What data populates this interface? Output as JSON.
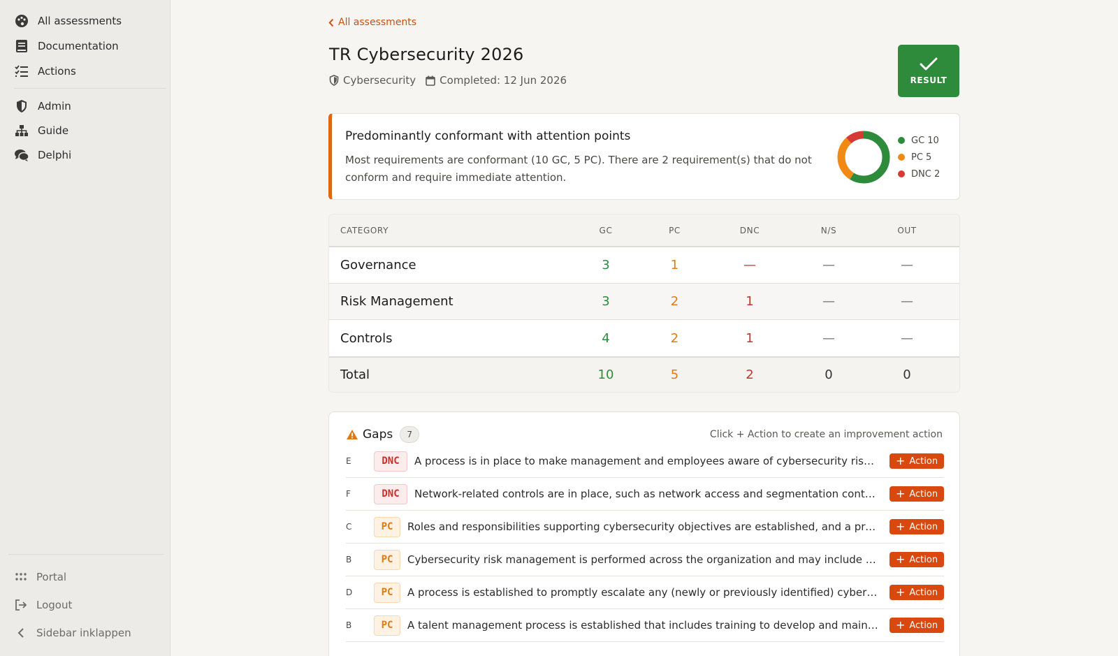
{
  "sidebar": {
    "nav": [
      {
        "label": "All assessments",
        "icon": "palette-icon"
      },
      {
        "label": "Documentation",
        "icon": "book-icon"
      },
      {
        "label": "Actions",
        "icon": "checklist-icon"
      },
      {
        "label": "Admin",
        "icon": "shield-icon"
      },
      {
        "label": "Guide",
        "icon": "sitemap-icon"
      },
      {
        "label": "Delphi",
        "icon": "comments-icon"
      }
    ],
    "bottom": [
      {
        "label": "Portal",
        "icon": "grid-icon"
      },
      {
        "label": "Logout",
        "icon": "logout-icon"
      },
      {
        "label": "Sidebar inklappen",
        "icon": "chevron-left-icon"
      }
    ]
  },
  "header": {
    "back_label": "All assessments",
    "title": "TR Cybersecurity 2026",
    "category": "Cybersecurity",
    "completed": "Completed: 12 Jun 2026",
    "result_label": "RESULT"
  },
  "summary": {
    "title": "Predominantly conformant with attention points",
    "text": "Most requirements are conformant (10 GC, 5 PC). There are 2 requirement(s) that do not conform and require immediate attention.",
    "donut": [
      {
        "label": "GC 10",
        "value": 10,
        "color": "#2e8b3c"
      },
      {
        "label": "PC 5",
        "value": 5,
        "color": "#f08a14"
      },
      {
        "label": "DNC 2",
        "value": 2,
        "color": "#d63a34"
      }
    ]
  },
  "table": {
    "headers": {
      "category": "CATEGORY",
      "gc": "GC",
      "pc": "PC",
      "dnc": "DNC",
      "ns": "N/S",
      "out": "OUT"
    },
    "rows": [
      {
        "category": "Governance",
        "gc": "3",
        "pc": "1",
        "dnc": "—",
        "ns": "—",
        "out": "—"
      },
      {
        "category": "Risk Management",
        "gc": "3",
        "pc": "2",
        "dnc": "1",
        "ns": "—",
        "out": "—"
      },
      {
        "category": "Controls",
        "gc": "4",
        "pc": "2",
        "dnc": "1",
        "ns": "—",
        "out": "—"
      }
    ],
    "total": {
      "category": "Total",
      "gc": "10",
      "pc": "5",
      "dnc": "2",
      "ns": "0",
      "out": "0"
    }
  },
  "gaps": {
    "title": "Gaps",
    "count": "7",
    "hint": "Click + Action to create an improvement action",
    "action_label": "Action",
    "items": [
      {
        "letter": "E",
        "status": "DNC",
        "text": "A process is in place to make management and employees aware of cybersecurity risks a..."
      },
      {
        "letter": "F",
        "status": "DNC",
        "text": "Network-related controls are in place, such as network access and segmentation controls..."
      },
      {
        "letter": "C",
        "status": "PC",
        "text": "Roles and responsibilities supporting cybersecurity objectives are established, and a proce..."
      },
      {
        "letter": "B",
        "status": "PC",
        "text": "Cybersecurity risk management is performed across the organization and may include the ..."
      },
      {
        "letter": "D",
        "status": "PC",
        "text": "A process is established to promptly escalate any (newly or previously identified) cybersec..."
      },
      {
        "letter": "B",
        "status": "PC",
        "text": "A talent management process is established that includes training to develop and maintain..."
      }
    ]
  }
}
